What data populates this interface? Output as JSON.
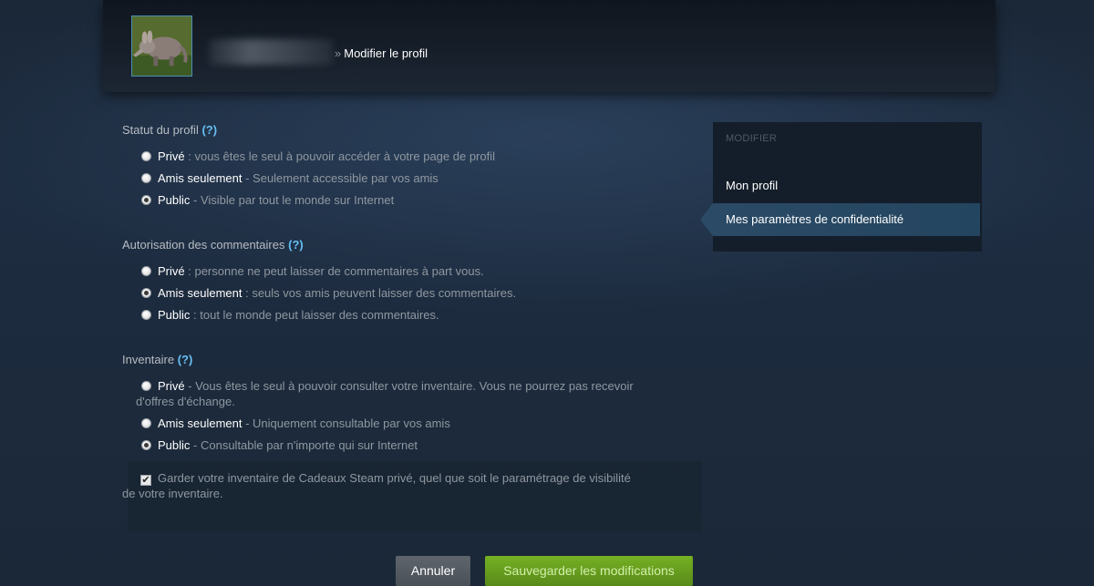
{
  "header": {
    "breadcrumb_sep": "»",
    "breadcrumb_current": "Modifier le profil",
    "avatar_icon": "aardvark-avatar"
  },
  "profile_status": {
    "title": "Statut du profil",
    "help": "(?)",
    "options": [
      {
        "label": "Privé",
        "desc": " : vous êtes le seul à pouvoir accéder à votre page de profil",
        "checked": false
      },
      {
        "label": "Amis seulement",
        "desc": " - Seulement accessible par vos amis",
        "checked": false
      },
      {
        "label": "Public",
        "desc": " - Visible par tout le monde sur Internet",
        "checked": true
      }
    ]
  },
  "comments": {
    "title": "Autorisation des commentaires",
    "help": "(?)",
    "options": [
      {
        "label": "Privé",
        "desc": " : personne ne peut laisser de commentaires à part vous.",
        "checked": false
      },
      {
        "label": "Amis seulement",
        "desc": " : seuls vos amis peuvent laisser des commentaires.",
        "checked": true
      },
      {
        "label": "Public",
        "desc": " : tout le monde peut laisser des commentaires.",
        "checked": false
      }
    ]
  },
  "inventory": {
    "title": "Inventaire",
    "help": "(?)",
    "options": [
      {
        "label": "Privé",
        "desc": " - Vous êtes le seul à pouvoir consulter votre inventaire. Vous ne pourrez pas recevoir",
        "desc_cont": "d'offres d'échange.",
        "checked": false
      },
      {
        "label": "Amis seulement",
        "desc": " - Uniquement consultable par vos amis",
        "checked": false
      },
      {
        "label": "Public",
        "desc": " - Consultable par n'importe qui sur Internet",
        "checked": true
      }
    ],
    "gift_checkbox": {
      "checked": true,
      "mark": "✔",
      "text": "Garder votre inventaire de Cadeaux Steam privé, quel que soit le paramétrage de visibilité",
      "text_cont": "de votre inventaire."
    }
  },
  "buttons": {
    "cancel": "Annuler",
    "save": "Sauvegarder les modifications"
  },
  "sidebar": {
    "title": "MODIFIER",
    "items": [
      {
        "label": "Mon profil",
        "active": false
      },
      {
        "label": "Mes paramètres de confidentialité",
        "active": true
      }
    ]
  }
}
